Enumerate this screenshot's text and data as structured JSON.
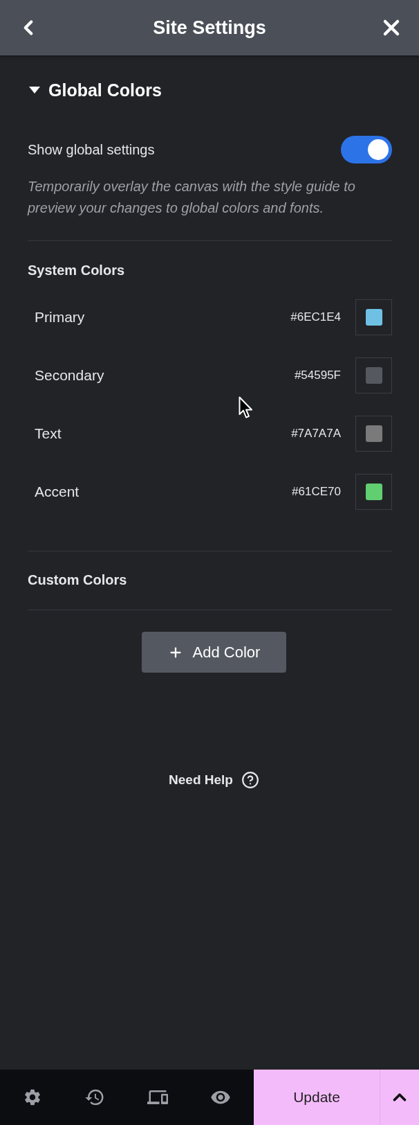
{
  "header": {
    "title": "Site Settings"
  },
  "section": {
    "title": "Global Colors",
    "expanded": true
  },
  "show_global_settings": {
    "label": "Show global settings",
    "on": true,
    "description": "Temporarily overlay the canvas with the style guide to preview your changes to global colors and fonts."
  },
  "system_colors": {
    "title": "System Colors",
    "items": [
      {
        "name": "Primary",
        "value": "#6EC1E4",
        "color": "#6ec1e4"
      },
      {
        "name": "Secondary",
        "value": "#54595F",
        "color": "#54595f"
      },
      {
        "name": "Text",
        "value": "#7A7A7A",
        "color": "#7a7a7a"
      },
      {
        "name": "Accent",
        "value": "#61CE70",
        "color": "#61ce70"
      }
    ]
  },
  "custom_colors": {
    "title": "Custom Colors",
    "add_button": "Add Color"
  },
  "help": {
    "label": "Need Help"
  },
  "footer": {
    "update_button": "Update"
  }
}
